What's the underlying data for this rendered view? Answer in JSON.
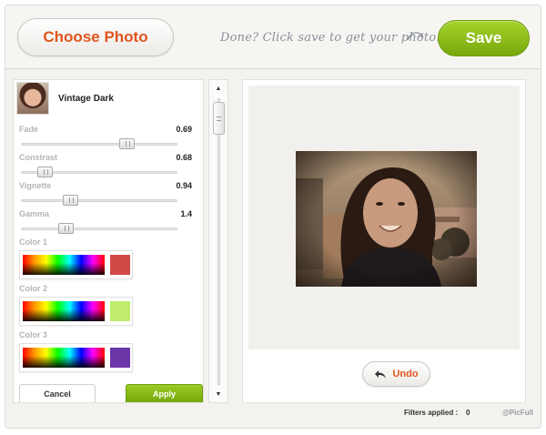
{
  "header": {
    "choose_label": "Choose Photo",
    "hint": "Done? Click save to get your photo!",
    "save_label": "Save",
    "accent_color": "#e0541e",
    "save_color": "#8cc21b"
  },
  "filter": {
    "name": "Vintage Dark",
    "params": [
      {
        "label": "Fade",
        "value": "0.69",
        "level": 0.69
      },
      {
        "label": "Constrast",
        "value": "0.68",
        "level": 0.11
      },
      {
        "label": "Vignette",
        "value": "0.94",
        "level": 0.29
      },
      {
        "label": "Gamma",
        "value": "1.4",
        "level": 0.26
      }
    ],
    "colors": [
      {
        "label": "Color 1",
        "swatch": "#d04a46"
      },
      {
        "label": "Color 2",
        "swatch": "#bfec6a"
      },
      {
        "label": "Color 3",
        "swatch": "#6c35a8"
      }
    ],
    "cancel_label": "Cancel",
    "apply_label": "Apply"
  },
  "scrollbar": {
    "up_icon": "triangle-up-icon",
    "down_icon": "triangle-down-icon"
  },
  "preview": {
    "undo_label": "Undo",
    "undo_icon": "undo-arrow-icon"
  },
  "footer": {
    "filters_label": "Filters applied :",
    "filters_count": "0",
    "credit": "@PicFull"
  }
}
